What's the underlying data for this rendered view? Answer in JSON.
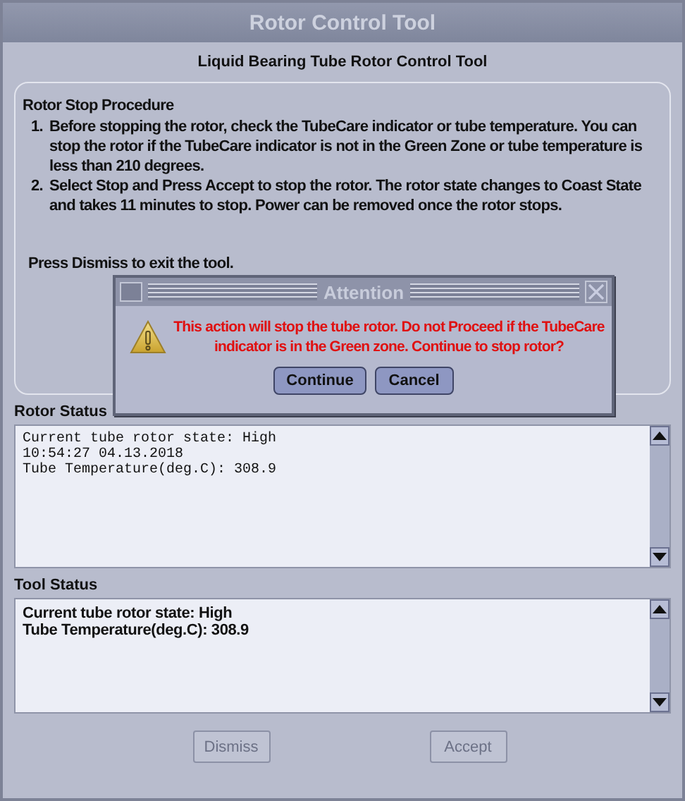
{
  "window": {
    "title": "Rotor Control Tool"
  },
  "heading": "Liquid Bearing Tube Rotor Control Tool",
  "procedure": {
    "title": "Rotor Stop Procedure",
    "steps": [
      {
        "number": "1.",
        "text": "Before stopping the rotor, check the TubeCare indicator or tube temperature. You can stop the rotor if the TubeCare indicator is not in the Green Zone or tube temperature is less than 210 degrees."
      },
      {
        "number": "2.",
        "text": "Select Stop and Press Accept to stop the rotor. The rotor state changes to Coast State and takes 11 minutes to stop. Power can be removed once the rotor stops."
      }
    ],
    "note": "Press Dismiss to exit the tool."
  },
  "rotor_status": {
    "label": "Rotor Status",
    "lines": [
      "Current tube rotor state: High",
      "10:54:27 04.13.2018",
      "Tube Temperature(deg.C): 308.9"
    ]
  },
  "tool_status": {
    "label": "Tool Status",
    "lines": [
      "Current tube rotor state: High",
      "Tube Temperature(deg.C): 308.9"
    ]
  },
  "buttons": [
    {
      "label": "Dismiss",
      "disabled": true
    },
    {
      "label": "Accept",
      "disabled": true
    }
  ],
  "dialog": {
    "title": "Attention",
    "message": "This action will stop the tube rotor. Do not Proceed if the TubeCare indicator is in the Green zone. Continue to stop rotor?",
    "buttons": [
      {
        "label": "Continue",
        "disabled": false
      },
      {
        "label": "Cancel",
        "disabled": false
      }
    ]
  }
}
